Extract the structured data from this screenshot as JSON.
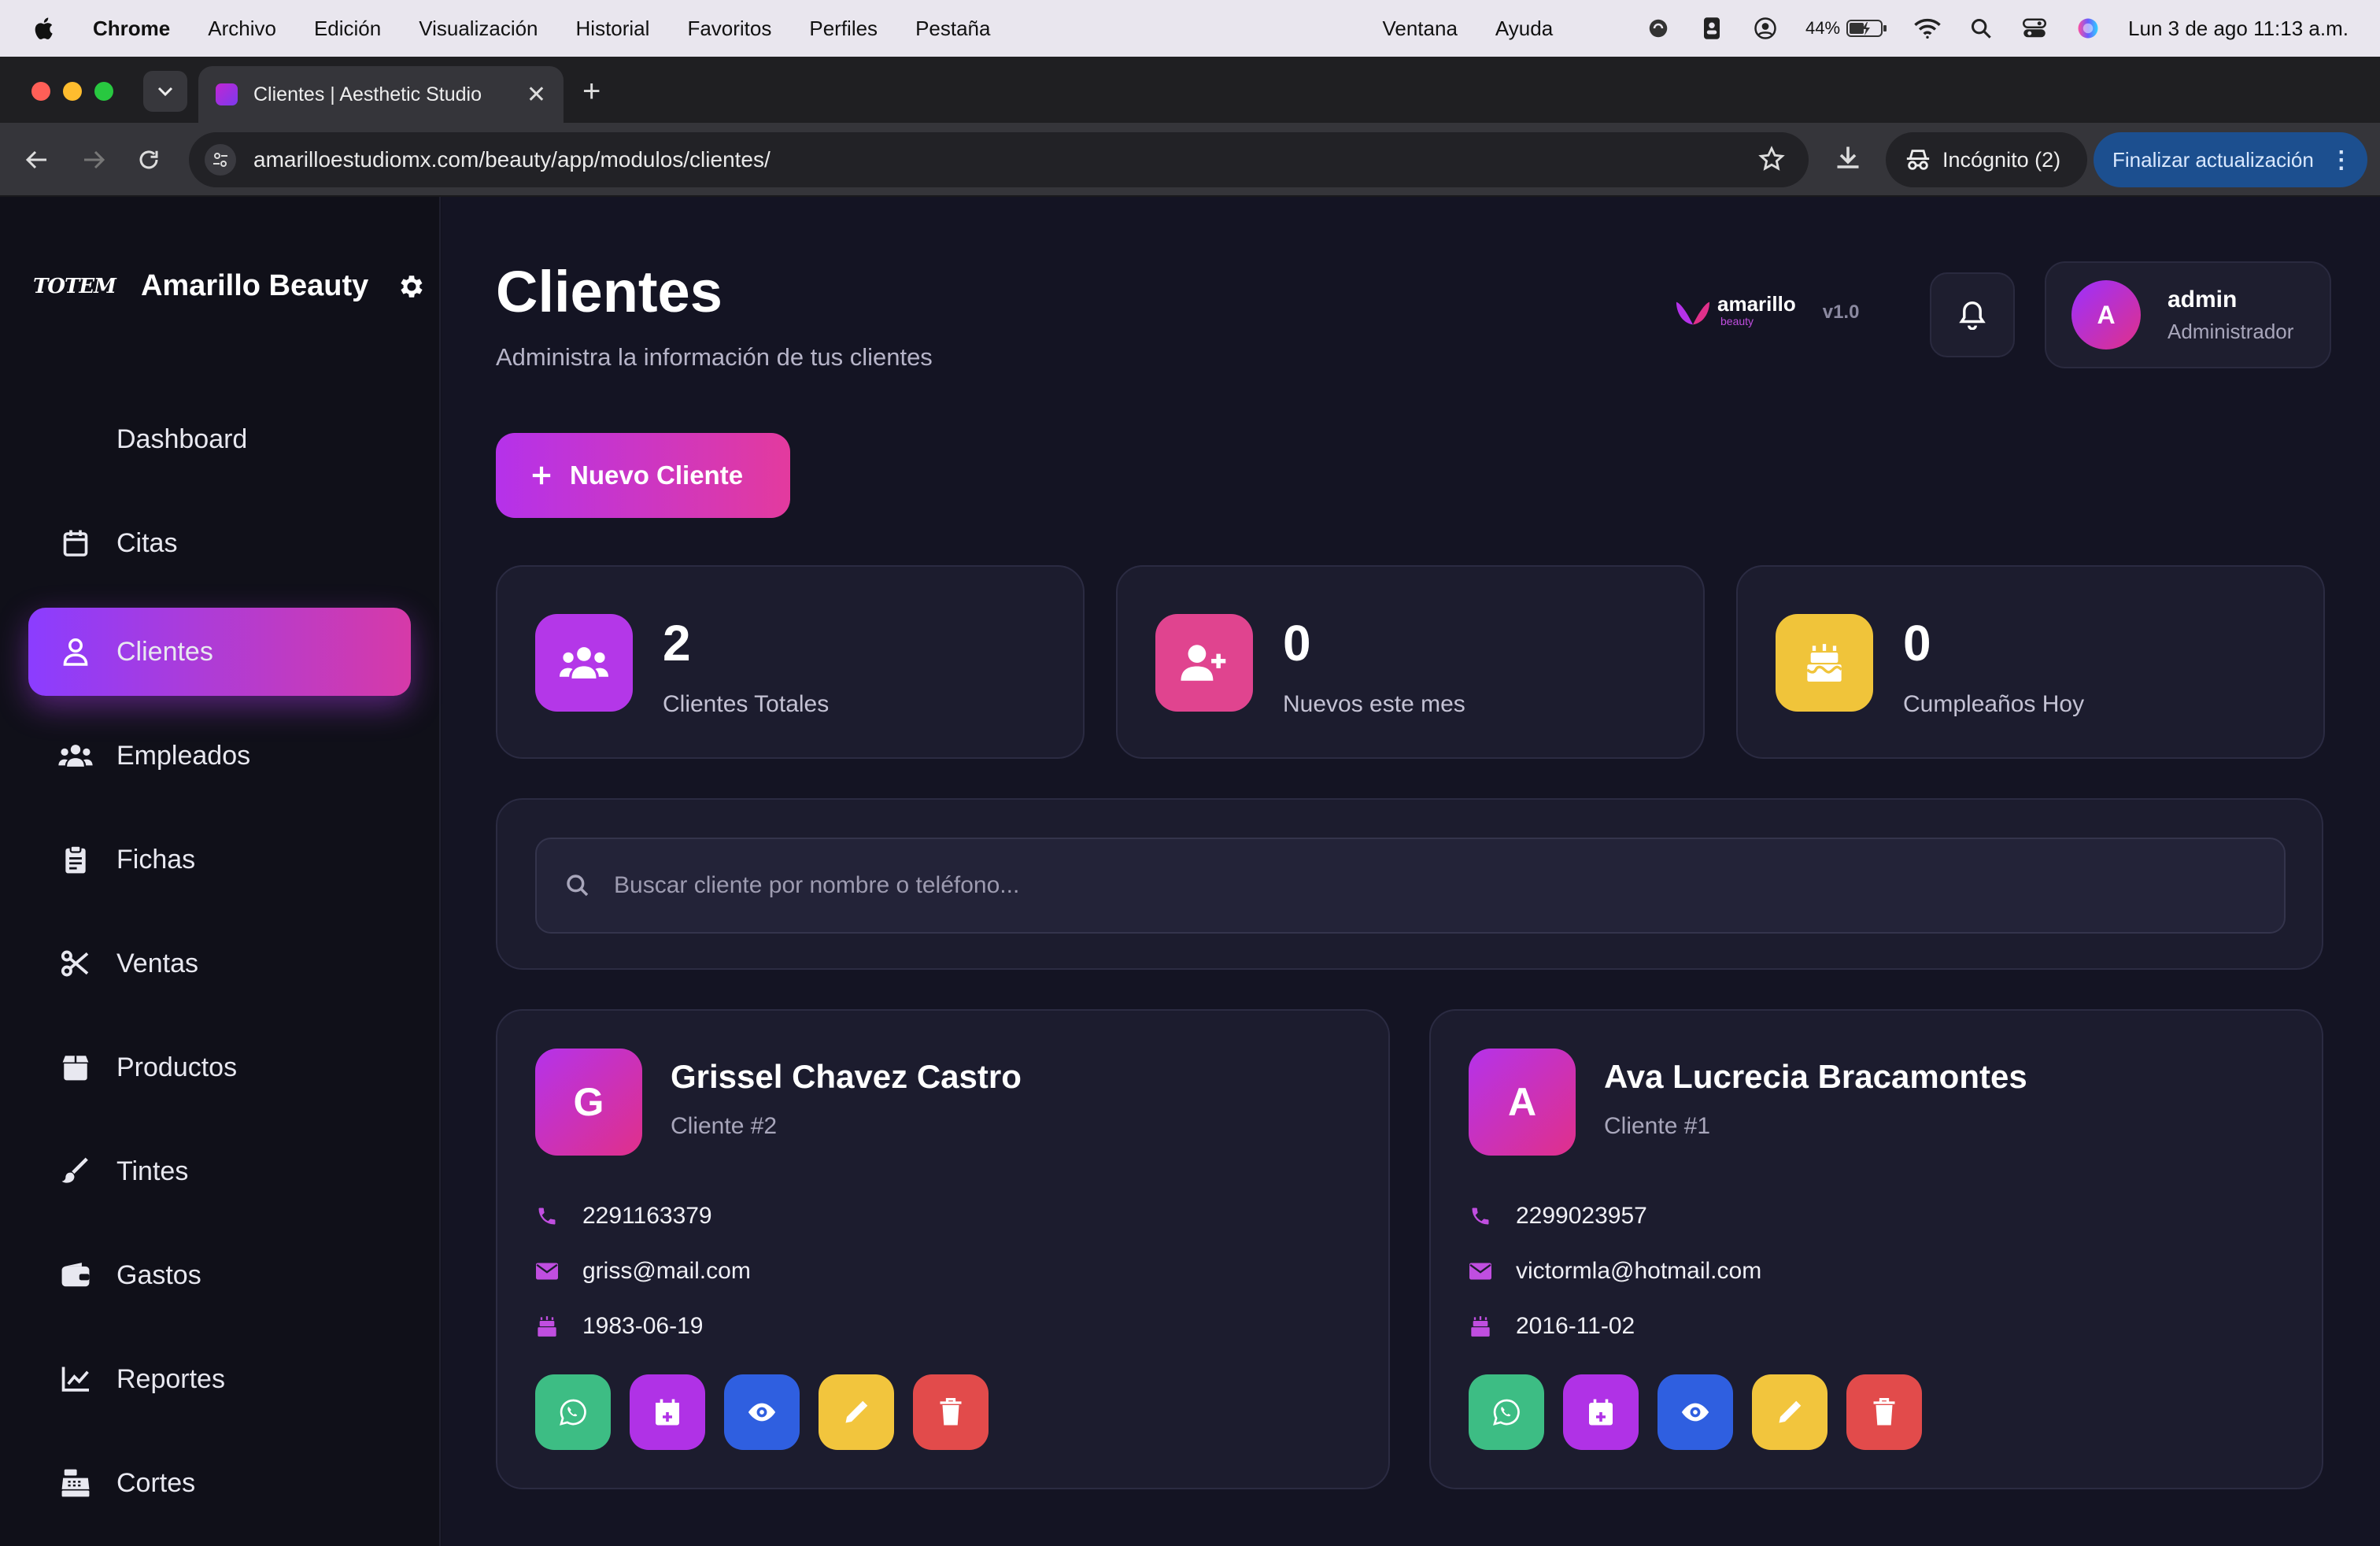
{
  "menubar": {
    "app": "Chrome",
    "items": [
      "Archivo",
      "Edición",
      "Visualización",
      "Historial",
      "Favoritos",
      "Perfiles",
      "Pestaña"
    ],
    "right_items": [
      "Ventana",
      "Ayuda"
    ],
    "battery": "44%",
    "datetime": "Lun 3 de ago  11:13 a.m."
  },
  "browser": {
    "tab_title": "Clientes | Aesthetic Studio",
    "url": "amarilloestudiomx.com/beauty/app/modulos/clientes/",
    "incognito_label": "Incógnito (2)",
    "update_label": "Finalizar actualización"
  },
  "sidebar": {
    "logo_text": "TOTEM",
    "brand": "Amarillo Beauty",
    "items": [
      {
        "label": "Dashboard",
        "icon": "none"
      },
      {
        "label": "Citas",
        "icon": "calendar-icon"
      },
      {
        "label": "Clientes",
        "icon": "user-icon",
        "active": true
      },
      {
        "label": "Empleados",
        "icon": "users-icon"
      },
      {
        "label": "Fichas",
        "icon": "clipboard-icon"
      },
      {
        "label": "Ventas",
        "icon": "scissors-icon"
      },
      {
        "label": "Productos",
        "icon": "box-icon"
      },
      {
        "label": "Tintes",
        "icon": "brush-icon"
      },
      {
        "label": "Gastos",
        "icon": "wallet-icon"
      },
      {
        "label": "Reportes",
        "icon": "chart-line-icon"
      },
      {
        "label": "Cortes",
        "icon": "cash-register-icon"
      }
    ]
  },
  "header": {
    "title": "Clientes",
    "subtitle": "Administra la información de tus clientes",
    "logo_name": "amarillo",
    "logo_sub": "beauty",
    "version": "v1.0",
    "user_initial": "A",
    "user_name": "admin",
    "user_role": "Administrador"
  },
  "actions": {
    "new_client": "Nuevo Cliente"
  },
  "stats": [
    {
      "value": "2",
      "label": "Clientes Totales",
      "color": "#b437e8"
    },
    {
      "value": "0",
      "label": "Nuevos este mes",
      "color": "#e0448f"
    },
    {
      "value": "0",
      "label": "Cumpleaños Hoy",
      "color": "#f0c43a"
    }
  ],
  "search": {
    "placeholder": "Buscar cliente por nombre o teléfono..."
  },
  "clients": [
    {
      "initial": "G",
      "name": "Grissel Chavez Castro",
      "number": "Cliente #2",
      "phone": "2291163379",
      "email": "griss@mail.com",
      "birthday": "1983-06-19"
    },
    {
      "initial": "A",
      "name": "Ava Lucrecia Bracamontes",
      "number": "Cliente #1",
      "phone": "2299023957",
      "email": "victormla@hotmail.com",
      "birthday": "2016-11-02"
    }
  ],
  "colors": {
    "accent_purple": "#8b3dff",
    "accent_pink": "#d63aa8",
    "whatsapp": "#3dbd84",
    "schedule": "#b032e6",
    "view": "#2f5fe0",
    "edit": "#f2c53d",
    "delete": "#e24b4b"
  }
}
